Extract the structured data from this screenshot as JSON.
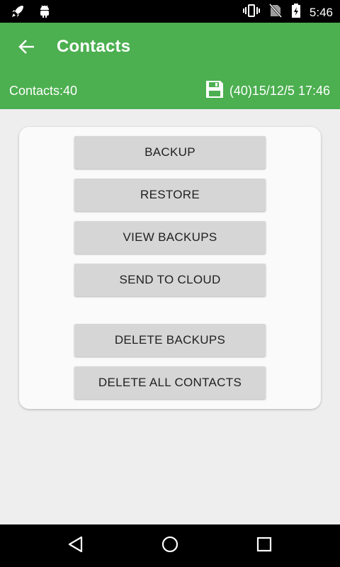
{
  "status_bar": {
    "time": "5:46",
    "left_icons": [
      "rocket-icon",
      "android-icon"
    ],
    "right_icons": [
      "vibrate-icon",
      "no-sim-icon",
      "battery-charging-icon"
    ]
  },
  "app_bar": {
    "title": "Contacts",
    "contacts_label": "Contacts:40",
    "backup_info": "(40)15/12/5 17:46",
    "backup_icon": "floppy-disk-icon",
    "back_icon": "arrow-back-icon",
    "color": "#4caf50"
  },
  "actions": {
    "backup": "BACKUP",
    "restore": "RESTORE",
    "view_backups": "VIEW BACKUPS",
    "send_to_cloud": "SEND TO CLOUD",
    "delete_backups": "DELETE BACKUPS",
    "delete_all_contacts": "DELETE ALL CONTACTS"
  },
  "nav_bar": {
    "icons": [
      "back-triangle-icon",
      "home-circle-icon",
      "recents-square-icon"
    ]
  }
}
